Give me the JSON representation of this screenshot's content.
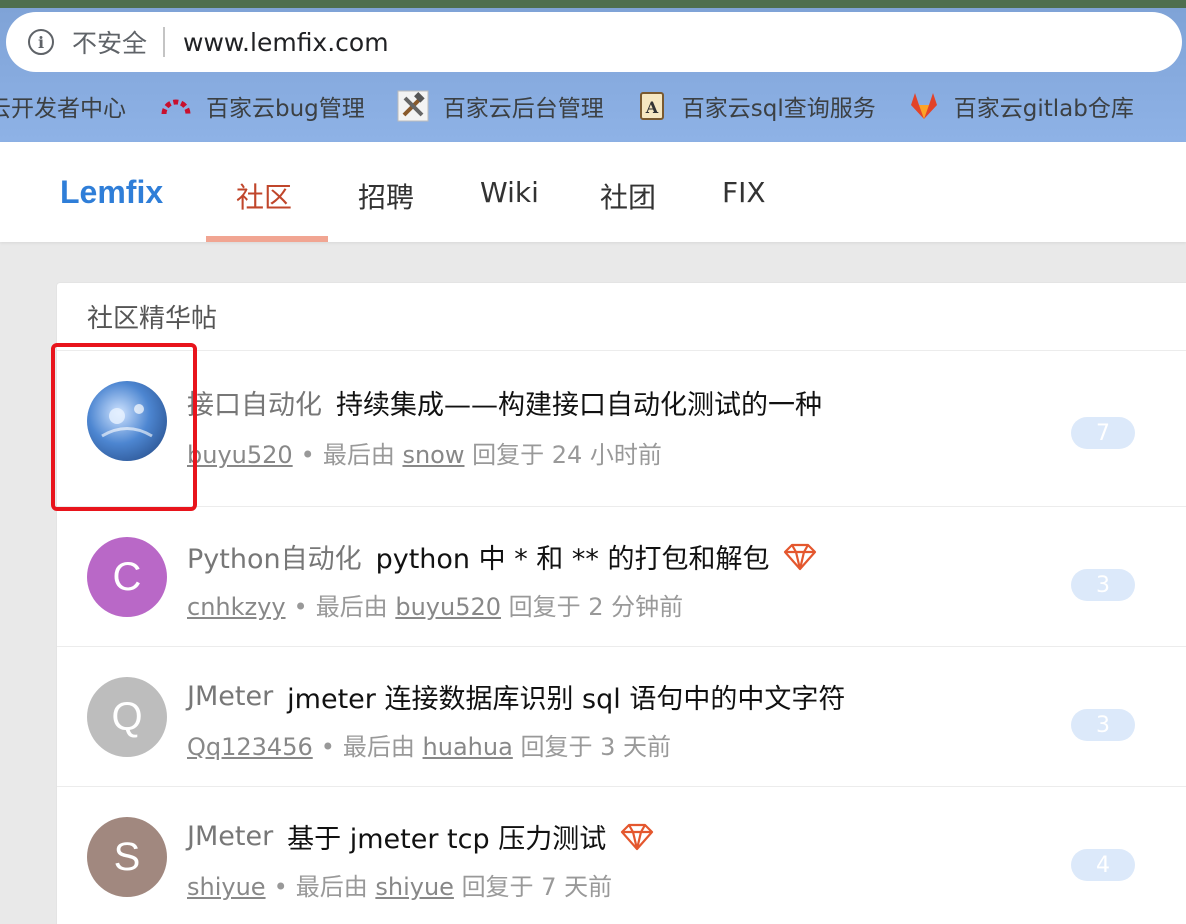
{
  "browser": {
    "security_label": "不安全",
    "url": "www.lemfix.com",
    "bookmarks": [
      {
        "label": "云开发者中心",
        "icon": "partial-icon"
      },
      {
        "label": "百家云bug管理",
        "icon": "bug-tracker-icon"
      },
      {
        "label": "百家云后台管理",
        "icon": "tools-icon"
      },
      {
        "label": "百家云sql查询服务",
        "icon": "script-icon"
      },
      {
        "label": "百家云gitlab仓库",
        "icon": "gitlab-icon"
      }
    ]
  },
  "site": {
    "brand": "Lemfix",
    "nav": [
      {
        "label": "社区",
        "active": true
      },
      {
        "label": "招聘",
        "active": false
      },
      {
        "label": "Wiki",
        "active": false
      },
      {
        "label": "社团",
        "active": false
      },
      {
        "label": "FIX",
        "active": false
      }
    ]
  },
  "panel": {
    "title": "社区精华帖",
    "topics": [
      {
        "node": "接口自动化",
        "title": "持续集成——构建接口自动化测试的一种",
        "author": "buyu520",
        "last_reply_prefix": "最后由",
        "last_replier": "snow",
        "reply_time": "回复于 24 小时前",
        "count": "7",
        "avatar_letter": "",
        "avatar_color": "#2a5fa8",
        "excellent": false
      },
      {
        "node": "Python自动化",
        "title": "python 中 * 和 ** 的打包和解包",
        "author": "cnhkzyy",
        "last_reply_prefix": "最后由",
        "last_replier": "buyu520",
        "reply_time": "回复于 2 分钟前",
        "count": "3",
        "avatar_letter": "C",
        "avatar_color": "#b968c7",
        "excellent": true
      },
      {
        "node": "JMeter",
        "title": "jmeter 连接数据库识别 sql 语句中的中文字符",
        "author": "Qq123456",
        "last_reply_prefix": "最后由",
        "last_replier": "huahua",
        "reply_time": "回复于 3 天前",
        "count": "3",
        "avatar_letter": "Q",
        "avatar_color": "#bdbdbd",
        "excellent": false
      },
      {
        "node": "JMeter",
        "title": "基于 jmeter tcp 压力测试",
        "author": "shiyue",
        "last_reply_prefix": "最后由",
        "last_replier": "shiyue",
        "reply_time": "回复于 7 天前",
        "count": "4",
        "avatar_letter": "S",
        "avatar_color": "#a1887f",
        "excellent": true
      }
    ]
  },
  "colors": {
    "brand": "#2f7ed8",
    "active_nav": "#c0462b",
    "highlight": "#e8141c",
    "excellent": "#e4572e"
  }
}
